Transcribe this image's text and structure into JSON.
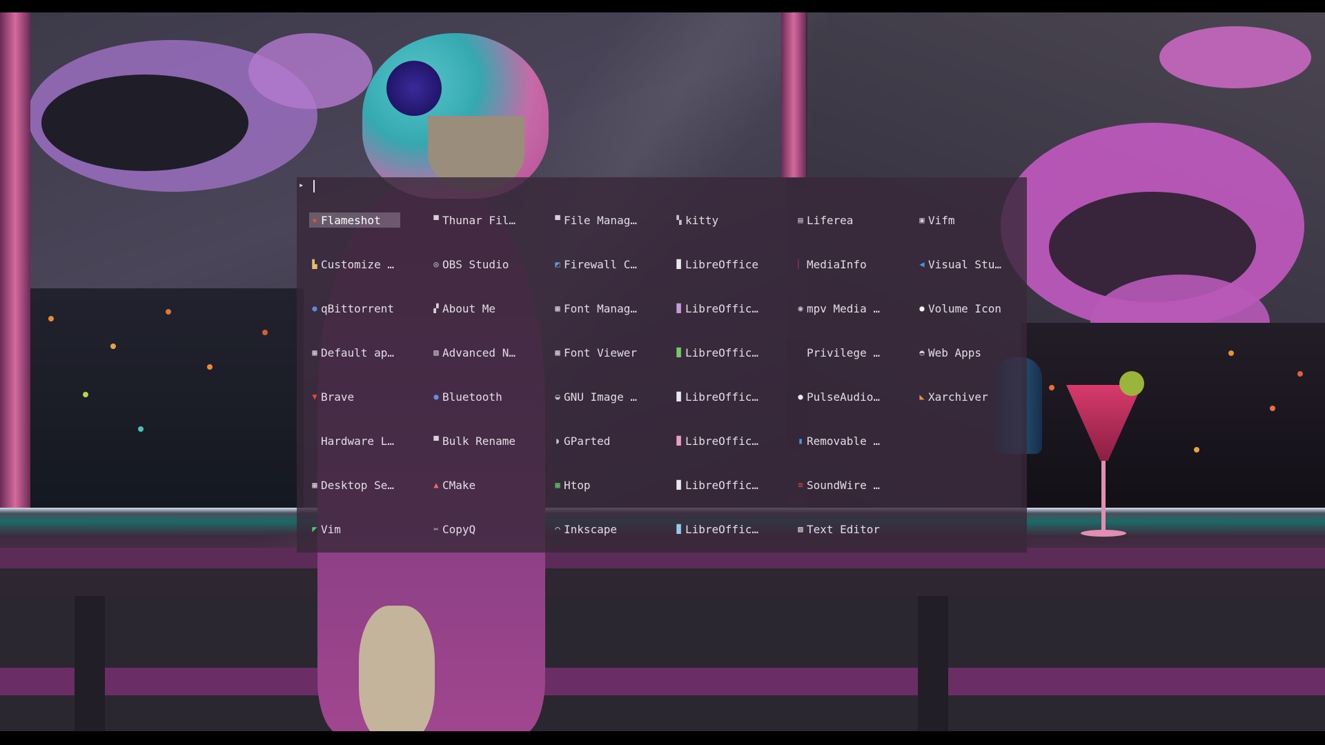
{
  "launcher": {
    "prompt_symbol": "▸",
    "query": "",
    "selected_index": 0,
    "entries": [
      {
        "label": "Flameshot",
        "icon": "flameshot-icon",
        "color": "#e0523a"
      },
      {
        "label": "Thunar Fil…",
        "icon": "folder-icon",
        "color": "#d8d0da"
      },
      {
        "label": "File Manag…",
        "icon": "folder-icon",
        "color": "#d8d0da"
      },
      {
        "label": "kitty",
        "icon": "kitty-icon",
        "color": "#c8c0cc"
      },
      {
        "label": "Liferea",
        "icon": "rss-icon",
        "color": "#c8c0cc"
      },
      {
        "label": "Vifm",
        "icon": "vifm-icon",
        "color": "#d8d0da"
      },
      {
        "label": "Customize …",
        "icon": "customize-icon",
        "color": "#e2c06a"
      },
      {
        "label": "OBS Studio",
        "icon": "obs-icon",
        "color": "#d8d0da"
      },
      {
        "label": "Firewall C…",
        "icon": "firewall-icon",
        "color": "#6a9ad8"
      },
      {
        "label": "LibreOffice",
        "icon": "document-icon",
        "color": "#e8e8ee"
      },
      {
        "label": "MediaInfo",
        "icon": "mediainfo-icon",
        "color": "#b43a5a"
      },
      {
        "label": "Visual Stu…",
        "icon": "vscode-icon",
        "color": "#3a9ae8"
      },
      {
        "label": "qBittorrent",
        "icon": "qbittorrent-icon",
        "color": "#5a8ad8"
      },
      {
        "label": "About Me",
        "icon": "about-me-icon",
        "color": "#d8d0da"
      },
      {
        "label": "Font Manag…",
        "icon": "font-icon",
        "color": "#d8d0da"
      },
      {
        "label": "LibreOffic…",
        "icon": "libreoffice-draw-icon",
        "color": "#c89ad8"
      },
      {
        "label": "mpv Media …",
        "icon": "mpv-icon",
        "color": "#c8c0cc"
      },
      {
        "label": "Volume Icon",
        "icon": "volume-icon",
        "color": "#ffffff"
      },
      {
        "label": "Default ap…",
        "icon": "default-apps-icon",
        "color": "#d8d0da"
      },
      {
        "label": "Advanced N…",
        "icon": "network-icon",
        "color": "#d8d0da"
      },
      {
        "label": "Font Viewer",
        "icon": "font-viewer-icon",
        "color": "#d8d0da"
      },
      {
        "label": "LibreOffic…",
        "icon": "libreoffice-calc-icon",
        "color": "#7ac86a"
      },
      {
        "label": "Privilege …",
        "icon": "",
        "color": ""
      },
      {
        "label": "Web Apps",
        "icon": "web-apps-icon",
        "color": "#d8d0da"
      },
      {
        "label": "Brave",
        "icon": "brave-icon",
        "color": "#e84a2a"
      },
      {
        "label": "Bluetooth",
        "icon": "bluetooth-icon",
        "color": "#6a8ae8"
      },
      {
        "label": "GNU Image …",
        "icon": "gimp-icon",
        "color": "#c8c0cc"
      },
      {
        "label": "LibreOffic…",
        "icon": "libreoffice-impress-icon",
        "color": "#e8e8ee"
      },
      {
        "label": "PulseAudio…",
        "icon": "pulseaudio-icon",
        "color": "#e8e8ee"
      },
      {
        "label": "Xarchiver",
        "icon": "archive-icon",
        "color": "#e8904a"
      },
      {
        "label": "Hardware L…",
        "icon": "",
        "color": ""
      },
      {
        "label": "Bulk Rename",
        "icon": "bulk-rename-icon",
        "color": "#d8d0da"
      },
      {
        "label": "GParted",
        "icon": "gparted-icon",
        "color": "#c8c0cc"
      },
      {
        "label": "LibreOffic…",
        "icon": "libreoffice-base-icon",
        "color": "#e8a0c8"
      },
      {
        "label": "Removable …",
        "icon": "usb-icon",
        "color": "#4a9ae8"
      },
      {
        "label": "",
        "icon": "",
        "color": ""
      },
      {
        "label": "Desktop Se…",
        "icon": "desktop-settings-icon",
        "color": "#d8d0da"
      },
      {
        "label": "CMake",
        "icon": "cmake-icon",
        "color": "#e86a6a"
      },
      {
        "label": "Htop",
        "icon": "htop-icon",
        "color": "#5ac86a"
      },
      {
        "label": "LibreOffic…",
        "icon": "libreoffice-writer-icon",
        "color": "#e8e8ee"
      },
      {
        "label": "SoundWire …",
        "icon": "soundwire-icon",
        "color": "#e84a3a"
      },
      {
        "label": "",
        "icon": "",
        "color": ""
      },
      {
        "label": "Vim",
        "icon": "vim-icon",
        "color": "#5ac86a"
      },
      {
        "label": "CopyQ",
        "icon": "copyq-icon",
        "color": "#d8d0da"
      },
      {
        "label": "Inkscape",
        "icon": "inkscape-icon",
        "color": "#e8e8ee"
      },
      {
        "label": "LibreOffic…",
        "icon": "libreoffice-math-icon",
        "color": "#9ac8e8"
      },
      {
        "label": "Text Editor",
        "icon": "text-editor-icon",
        "color": "#e8e0d8"
      },
      {
        "label": "",
        "icon": "",
        "color": ""
      }
    ]
  },
  "colors": {
    "launcher_bg": "rgba(56,40,58,0.80)",
    "text": "#e3dde6",
    "selected_bg": "rgba(220,210,225,0.28)"
  }
}
